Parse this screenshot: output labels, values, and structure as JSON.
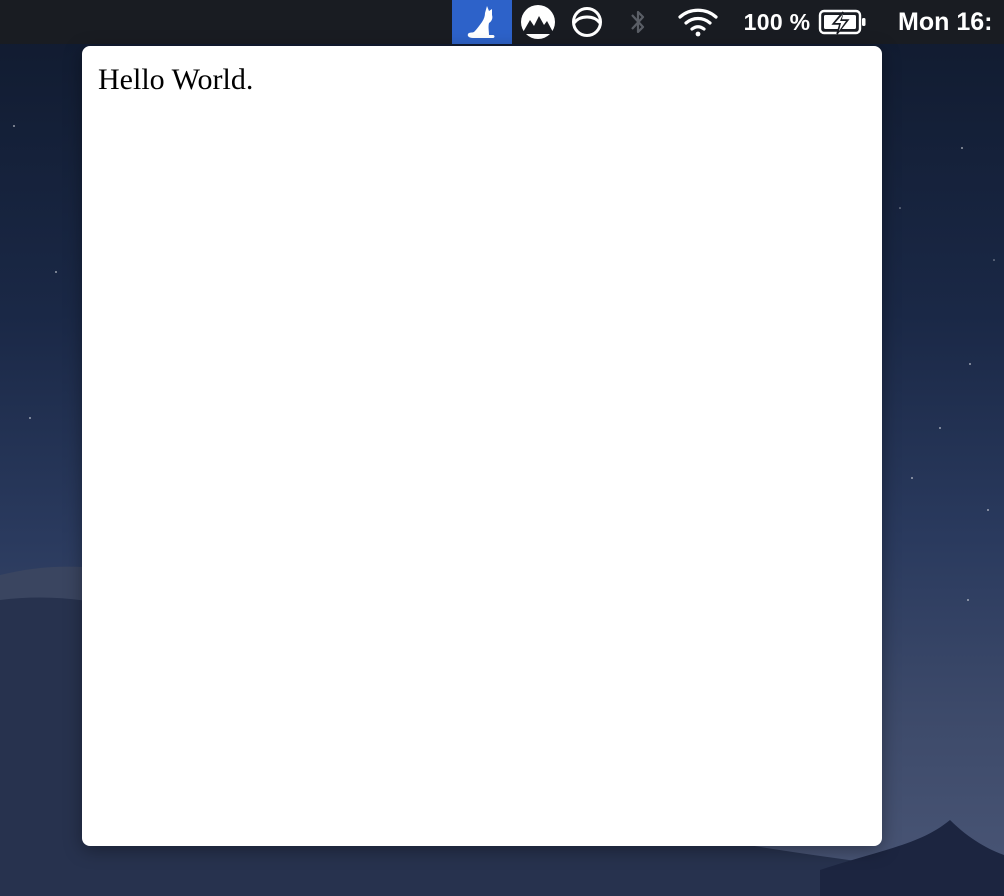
{
  "menubar": {
    "status_items": [
      {
        "icon": "cat-icon",
        "active": true,
        "highlight_color": "#2d62c9"
      },
      {
        "icon": "mountain-icon"
      },
      {
        "icon": "circle-globe-icon"
      },
      {
        "icon": "bluetooth-icon",
        "state": "disabled"
      },
      {
        "icon": "wifi-icon"
      }
    ],
    "battery_percent": "100 %",
    "battery_icon": "battery-charging-icon",
    "clock": "Mon 16:"
  },
  "popover": {
    "text": "Hello World."
  },
  "colors": {
    "menubar_background": "#191c22",
    "active_highlight": "#2d62c9",
    "popover_background": "#ffffff"
  }
}
